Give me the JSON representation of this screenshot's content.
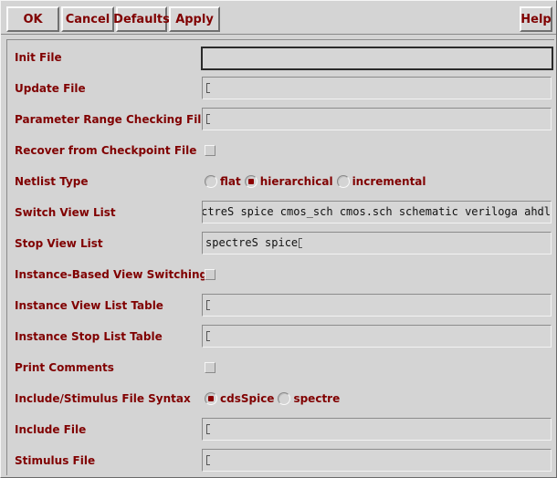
{
  "toolbar": {
    "ok": "OK",
    "cancel": "Cancel",
    "defaults": "Defaults",
    "apply": "Apply",
    "help": "Help"
  },
  "form": {
    "init_file": {
      "label": "Init File",
      "value": ""
    },
    "update_file": {
      "label": "Update File",
      "value": ""
    },
    "param_range_file": {
      "label": "Parameter Range Checking File",
      "value": ""
    },
    "recover_checkpoint": {
      "label": "Recover from Checkpoint File",
      "checked": false
    },
    "netlist_type": {
      "label": "Netlist Type",
      "options": [
        "flat",
        "hierarchical",
        "incremental"
      ],
      "selected": "hierarchical"
    },
    "switch_view_list": {
      "label": "Switch View List",
      "value": "spectreS spice cmos_sch cmos.sch schematic veriloga ahdl"
    },
    "stop_view_list": {
      "label": "Stop View List",
      "value": "spectreS spice"
    },
    "instance_view_switching": {
      "label": "Instance-Based View Switching",
      "checked": false
    },
    "instance_view_list_table": {
      "label": "Instance View List Table",
      "value": ""
    },
    "instance_stop_list_table": {
      "label": "Instance Stop List Table",
      "value": ""
    },
    "print_comments": {
      "label": "Print Comments",
      "checked": false
    },
    "file_syntax": {
      "label": "Include/Stimulus File Syntax",
      "options": [
        "cdsSpice",
        "spectre"
      ],
      "selected": "cdsSpice"
    },
    "include_file": {
      "label": "Include File",
      "value": ""
    },
    "stimulus_file": {
      "label": "Stimulus File",
      "value": ""
    }
  }
}
